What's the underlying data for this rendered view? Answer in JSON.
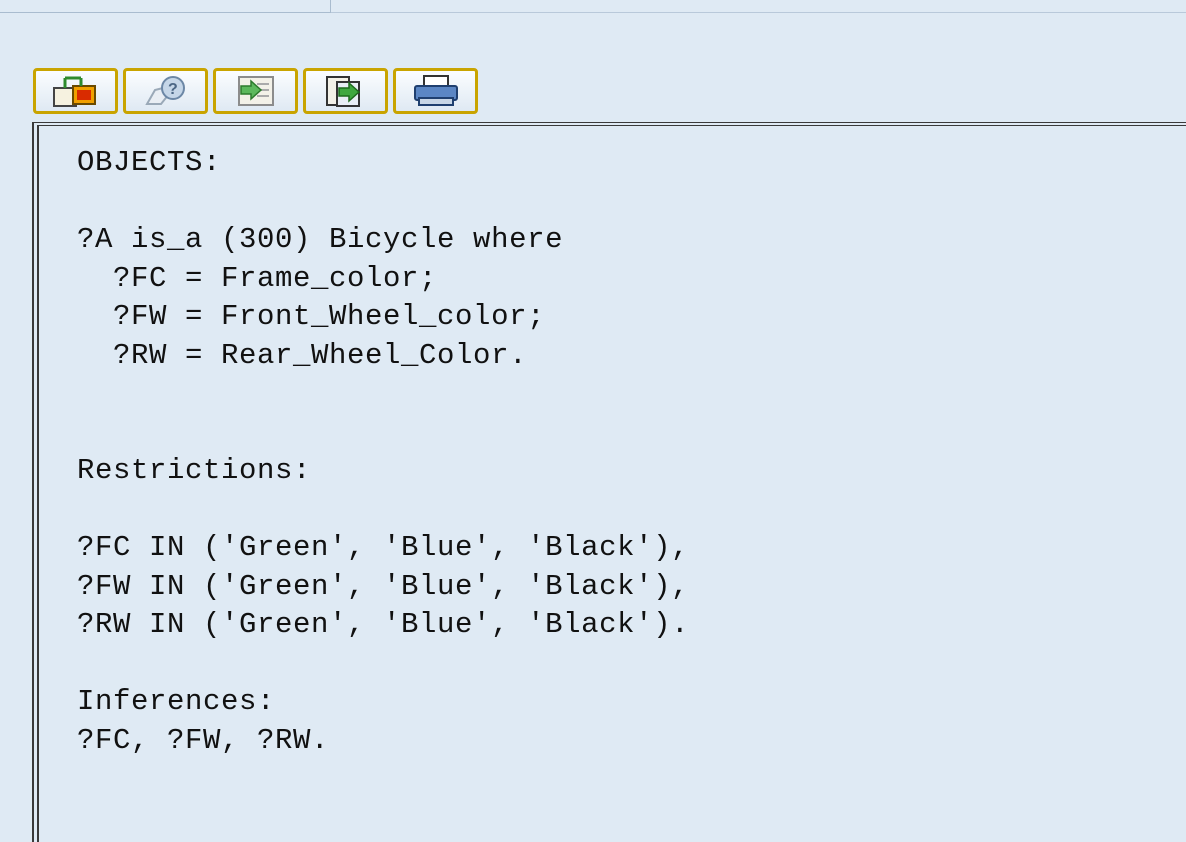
{
  "toolbar": {
    "buttons": [
      {
        "name": "structure-button",
        "icon": "hierarchy-icon"
      },
      {
        "name": "help-button",
        "icon": "help-hand-icon"
      },
      {
        "name": "import-button",
        "icon": "import-document-icon"
      },
      {
        "name": "export-button",
        "icon": "export-document-icon"
      },
      {
        "name": "print-button",
        "icon": "printer-icon"
      }
    ]
  },
  "editor": {
    "lines": [
      "OBJECTS:",
      "",
      "?A is_a (300) Bicycle where",
      "  ?FC = Frame_color;",
      "  ?FW = Front_Wheel_color;",
      "  ?RW = Rear_Wheel_Color.",
      "",
      "",
      "Restrictions:",
      "",
      "?FC IN ('Green', 'Blue', 'Black'),",
      "?FW IN ('Green', 'Blue', 'Black'),",
      "?RW IN ('Green', 'Blue', 'Black').",
      "",
      "Inferences:",
      "?FC, ?FW, ?RW."
    ]
  },
  "colors": {
    "background": "#dfeaf4",
    "button_border": "#c9a400",
    "text": "#111111"
  }
}
